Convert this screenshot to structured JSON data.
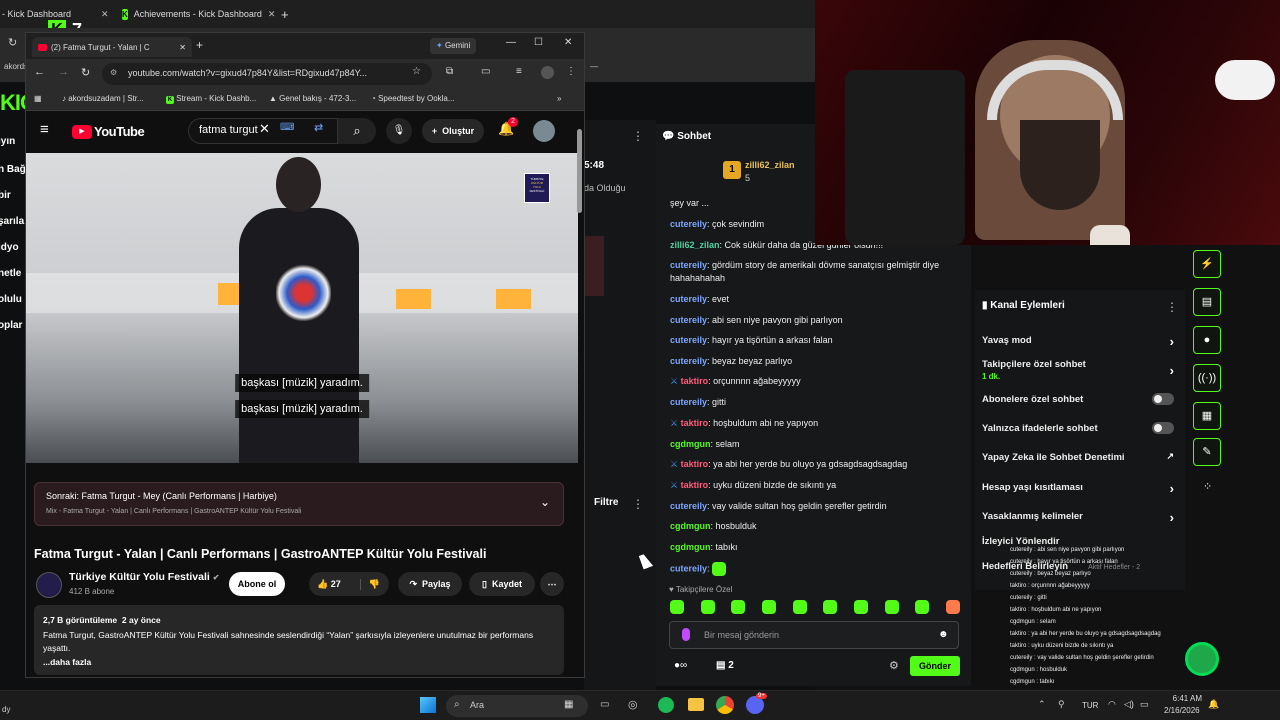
{
  "bg_browser": {
    "tab1": "- Kick Dashboard",
    "tab2": "Achievements - Kick Dashboard",
    "addr_partial": "akords",
    "badge_number": "7",
    "side_fragments": [
      "ıyın",
      "n Bağ",
      "bir",
      "şarıla",
      "idyo",
      "netle",
      "olulu",
      "oplar"
    ],
    "stream_time": "5:48",
    "stream_sub": "da Olduğu",
    "filter_label": "Filtre"
  },
  "win": {
    "tab_title": "(2) Fatma Turgut - Yalan | C",
    "gemini_label": "Gemini",
    "url": "youtube.com/watch?v=gixud47p84Y&list=RDgixud47p84Y...",
    "bookmarks": [
      "akordsuzadam | Str...",
      "Stream - Kick Dashb...",
      "Genel bakış - 472-3...",
      "Speedtest by Ookla..."
    ]
  },
  "yt": {
    "logo": "YouTube",
    "search_value": "fatma turgut",
    "create_label": "Oluştur",
    "notif_count": "2",
    "festival_logo": [
      "TÜRKİYE",
      "KÜLTÜR",
      "YOLU",
      "FESTİVALİ"
    ],
    "subtitle1": "başkası [müzik] yaradım.",
    "subtitle2": "başkası [müzik] yaradım.",
    "next_title": "Sonraki: Fatma Turgut - Mey (Canlı Performans | Harbiye)",
    "next_sub": "Mix - Fatma Turgut - Yalan | Canlı Performans | GastroANTEP Kültür Yolu Festivali",
    "title": "Fatma Turgut - Yalan | Canlı Performans | GastroANTEP Kültür Yolu Festivali",
    "channel": "Türkiye Kültür Yolu Festivali",
    "subs": "412 B abone",
    "subscribe": "Abone ol",
    "likes": "27",
    "share": "Paylaş",
    "save": "Kaydet",
    "views": "2,7 B görüntüleme  2 ay önce",
    "desc": "Fatma Turgut, GastroANTEP Kültür Yolu Festivali sahnesinde seslendirdiği “Yalan” şarkısıyla izleyenlere unutulmaz bir performans yaşattı.",
    "more": "...daha fazla"
  },
  "chat": {
    "title": "Sohbet",
    "top_user": "zilli62_zilan",
    "top_rank": "1",
    "top_count": "5",
    "cut_line": "şey var ...",
    "messages": [
      {
        "user": "cutereily",
        "text": "çok sevindim",
        "color": "#7aa7ff"
      },
      {
        "user": "zilli62_zilan",
        "text": "Cok sükür daha da güzel günler olsun!!!",
        "color": "#4fd0a0"
      },
      {
        "user": "cutereily",
        "text": "gördüm story de amerikalı dövme sanatçısı gelmiştir diye hahahahahah",
        "color": "#7aa7ff"
      },
      {
        "user": "cutereily",
        "text": "evet",
        "color": "#7aa7ff"
      },
      {
        "user": "cutereily",
        "text": "abi sen niye pavyon gibi parlıyon",
        "color": "#7aa7ff"
      },
      {
        "user": "cutereily",
        "text": "hayır ya tişörtün a arkası falan",
        "color": "#7aa7ff"
      },
      {
        "user": "cutereily",
        "text": "beyaz beyaz parlıyo",
        "color": "#7aa7ff"
      },
      {
        "user": "taktiro",
        "text": "orçunnnn ağabeyyyyy",
        "color": "#ff5c7a"
      },
      {
        "user": "cutereily",
        "text": "gitti",
        "color": "#7aa7ff"
      },
      {
        "user": "taktiro",
        "text": "hoşbuldum abi ne yapıyon",
        "color": "#ff5c7a"
      },
      {
        "user": "cgdmgun",
        "text": "selam",
        "color": "#53fc18"
      },
      {
        "user": "taktiro",
        "text": "ya abi her yerde bu oluyo ya gdsagdsagdsagdag",
        "color": "#ff5c7a"
      },
      {
        "user": "taktiro",
        "text": "uyku düzeni bizde de sıkıntı ya",
        "color": "#ff5c7a"
      },
      {
        "user": "cutereily",
        "text": "vay valide sultan hoş geldin şerefler getirdin",
        "color": "#7aa7ff"
      },
      {
        "user": "cgdmgun",
        "text": "hosbulduk",
        "color": "#53fc18"
      },
      {
        "user": "cgdmgun",
        "text": "tabıkı",
        "color": "#53fc18"
      },
      {
        "user": "cutereily",
        "text": "",
        "color": "#7aa7ff"
      }
    ],
    "followers_only": "Takipçilere Özel",
    "placeholder": "Bir mesaj gönderin",
    "viewer_count": "2",
    "send_label": "Gönder"
  },
  "actions": {
    "title": "Kanal Eylemleri",
    "items": [
      "Yavaş mod",
      "Takipçilere özel sohbet",
      "Abonelere özel sohbet",
      "Yalnızca ifadelerle sohbet",
      "Yapay Zeka ile Sohbet Denetimi",
      "Hesap yaşı kısıtlaması",
      "Yasaklanmış kelimeler",
      "İzleyici Yönlendir",
      "Hedefleri Belirleyin"
    ],
    "followers_sub": "1 dk.",
    "aktif": "Aktif Hedefler - 2"
  },
  "overlay_chat": [
    "cutereily : abi sen niye pavyon gibi parlıyon",
    "cutereily : hayır ya tişörtün a arkası falan",
    "cutereily : beyaz beyaz parlıyo",
    "taktiro : orçunnnn ağabeyyyyy",
    "cutereily : gitti",
    "taktiro : hoşbuldum abi ne yapıyon",
    "cgdmgun : selam",
    "taktiro : ya abi her yerde bu oluyo ya gdsagdsagdsagdag",
    "taktiro : uyku düzeni bizde de sıkıntı ya",
    "cutereily : vay valide sultan hoş geldin şerefler getirdin",
    "cgdmgun : hosbulduk",
    "cgdmgun : tabıkı",
    "cutereily :"
  ],
  "taskbar": {
    "search": "Ara",
    "lang": "TUR",
    "time": "6:41 AM",
    "date": "2/16/2026",
    "left_text": "dy",
    "discord_badge": "9+"
  },
  "colors": {
    "kick_green": "#53fc18",
    "yt_red": "#ff0033"
  }
}
